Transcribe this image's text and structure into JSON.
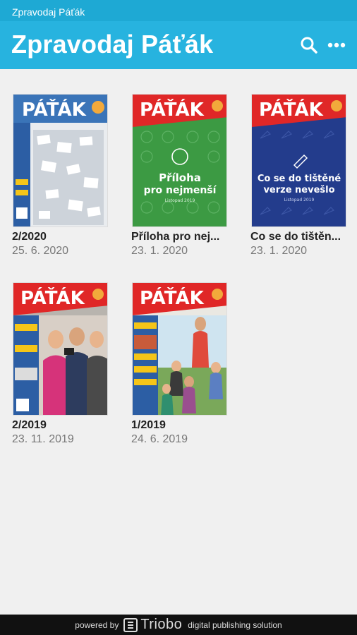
{
  "statusbar": {
    "app_name": "Zpravodaj Páťák"
  },
  "appbar": {
    "title": "Zpravodaj Páťák",
    "actions": [
      {
        "icon": "search-icon"
      },
      {
        "icon": "more-icon"
      }
    ]
  },
  "colors": {
    "header": "#27b3df",
    "statusbar": "#1ea9d4",
    "footer": "#111111",
    "background": "#f0f0f0"
  },
  "issues": [
    {
      "title": "2/2020",
      "date": "25. 6. 2020",
      "cover": {
        "masthead": "PÁŤÁK",
        "style": "photo-blue"
      }
    },
    {
      "title": "Příloha pro nej...",
      "date": "23. 1. 2020",
      "cover": {
        "masthead": "PÁŤÁK",
        "style": "green",
        "headline_1": "Příloha",
        "headline_2": "pro nejmenší",
        "subline": "Listopad 2019"
      }
    },
    {
      "title": "Co se do tištěn...",
      "date": "23. 1. 2020",
      "cover": {
        "masthead": "PÁŤÁK",
        "style": "navy",
        "headline_1": "Co se do tištěné",
        "headline_2": "verze nevešlo",
        "subline": "Listopad 2019"
      }
    },
    {
      "title": "2/2019",
      "date": "23. 11. 2019",
      "cover": {
        "masthead": "PÁŤÁK",
        "style": "photo-kids"
      }
    },
    {
      "title": "1/2019",
      "date": "24. 6. 2019",
      "cover": {
        "masthead": "PÁŤÁK",
        "style": "photo-outdoor"
      }
    }
  ],
  "footer": {
    "powered": "powered by",
    "brand": "Triobo",
    "tagline": "digital publishing solution"
  }
}
